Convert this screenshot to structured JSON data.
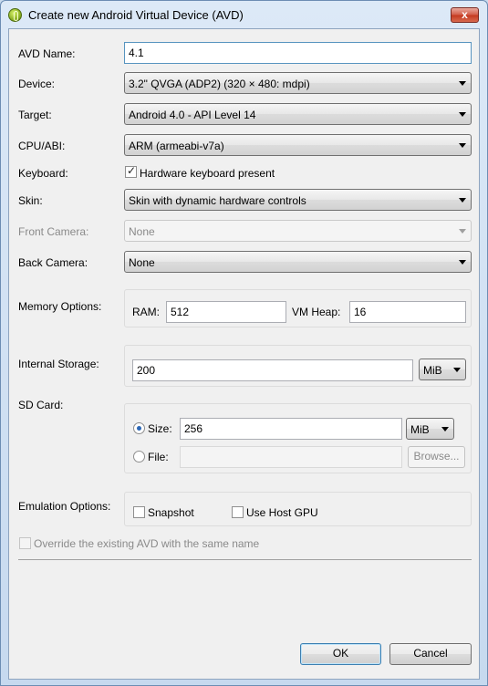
{
  "window": {
    "title": "Create new Android Virtual Device (AVD)",
    "close_label": "x"
  },
  "avd_name": {
    "label": "AVD Name:",
    "value": "4.1"
  },
  "device": {
    "label": "Device:",
    "value": "3.2\" QVGA (ADP2) (320 × 480: mdpi)"
  },
  "target": {
    "label": "Target:",
    "value": "Android 4.0 - API Level 14"
  },
  "cpu_abi": {
    "label": "CPU/ABI:",
    "value": "ARM (armeabi-v7a)"
  },
  "keyboard": {
    "label": "Keyboard:",
    "checkbox_label": "Hardware keyboard present",
    "checked": true
  },
  "skin": {
    "label": "Skin:",
    "value": "Skin with dynamic hardware controls"
  },
  "front_camera": {
    "label": "Front Camera:",
    "value": "None"
  },
  "back_camera": {
    "label": "Back Camera:",
    "value": "None"
  },
  "memory": {
    "label": "Memory Options:",
    "ram_label": "RAM:",
    "ram_value": "512",
    "vm_heap_label": "VM Heap:",
    "vm_heap_value": "16"
  },
  "internal_storage": {
    "label": "Internal Storage:",
    "value": "200",
    "unit": "MiB"
  },
  "sd_card": {
    "label": "SD Card:",
    "size_label": "Size:",
    "size_value": "256",
    "size_unit": "MiB",
    "file_label": "File:",
    "file_value": "",
    "browse_label": "Browse..."
  },
  "emulation": {
    "label": "Emulation Options:",
    "snapshot_label": "Snapshot",
    "host_gpu_label": "Use Host GPU"
  },
  "override": {
    "label": "Override the existing AVD with the same name"
  },
  "buttons": {
    "ok": "OK",
    "cancel": "Cancel"
  }
}
